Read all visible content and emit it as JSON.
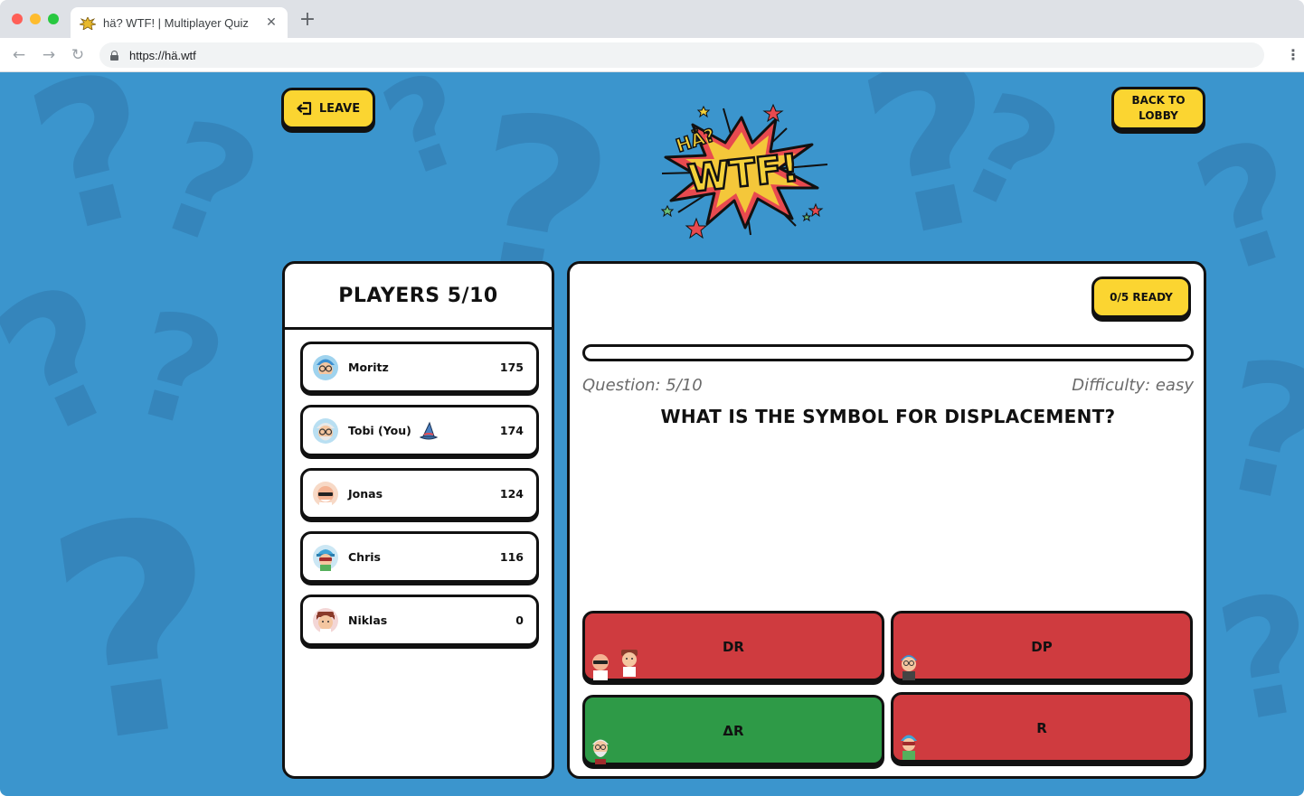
{
  "browser": {
    "tab_title": "hä? WTF! | Multiplayer Quiz",
    "tab_close": "✕",
    "new_tab": "+",
    "url": "https://hä.wtf",
    "nav_back": "←",
    "nav_forward": "→",
    "nav_reload": "↻",
    "menu": "⋮"
  },
  "header": {
    "leave_label": "LEAVE",
    "back_to_lobby_label": "BACK TO LOBBY",
    "logo_text_small": "HÄ?",
    "logo_text_big": "WTF!"
  },
  "players_panel": {
    "title": "PLAYERS 5/10",
    "players": [
      {
        "name": "Moritz",
        "score": "175",
        "avatar": "glasses-blue-hair-avatar"
      },
      {
        "name": "Tobi (You)",
        "score": "174",
        "avatar": "glasses-white-hair-avatar",
        "badge": "wizard-hat-icon"
      },
      {
        "name": "Jonas",
        "score": "124",
        "avatar": "sunglasses-bald-avatar"
      },
      {
        "name": "Chris",
        "score": "116",
        "avatar": "beanie-sunglasses-avatar"
      },
      {
        "name": "Niklas",
        "score": "0",
        "avatar": "brown-hair-avatar"
      }
    ]
  },
  "quiz": {
    "ready_label": "0/5 READY",
    "progress": 0,
    "question_counter": "Question: 5/10",
    "difficulty": "Difficulty: easy",
    "question": "WHAT IS THE SYMBOL FOR DISPLACEMENT?",
    "answers": [
      {
        "label": "DR",
        "state": "wrong",
        "voters": [
          "Jonas",
          "Niklas"
        ]
      },
      {
        "label": "DP",
        "state": "wrong",
        "voters": [
          "Moritz"
        ]
      },
      {
        "label": "ΔR",
        "state": "correct",
        "voters": [
          "Tobi (You)"
        ]
      },
      {
        "label": "R",
        "state": "wrong",
        "voters": [
          "Chris"
        ]
      }
    ]
  },
  "colors": {
    "background": "#3b95cd",
    "button_yellow": "#fbd531",
    "wrong_red": "#cf3b3f",
    "correct_green": "#2e9a47",
    "outline": "#111111"
  }
}
